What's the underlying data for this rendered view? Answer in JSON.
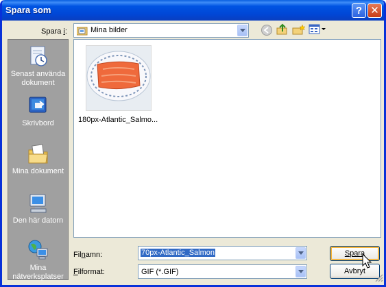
{
  "window": {
    "title": "Spara som"
  },
  "lookin": {
    "label": "Spara i:",
    "value": "Mina bilder"
  },
  "places": [
    {
      "label": "Senast använda dokument",
      "icon": "recent-documents-icon"
    },
    {
      "label": "Skrivbord",
      "icon": "desktop-icon"
    },
    {
      "label": "Mina dokument",
      "icon": "my-documents-icon"
    },
    {
      "label": "Den här datorn",
      "icon": "my-computer-icon"
    },
    {
      "label": "Mina nätverksplatser",
      "icon": "network-places-icon"
    }
  ],
  "files": [
    {
      "name": "180px-Atlantic_Salmo..."
    }
  ],
  "filename": {
    "label": "Filnamn:",
    "value": "70px-Atlantic_Salmon"
  },
  "filetype": {
    "label": "Filformat:",
    "value": "GIF (*.GIF)"
  },
  "buttons": {
    "save": "Spara",
    "cancel": "Avbryt"
  }
}
